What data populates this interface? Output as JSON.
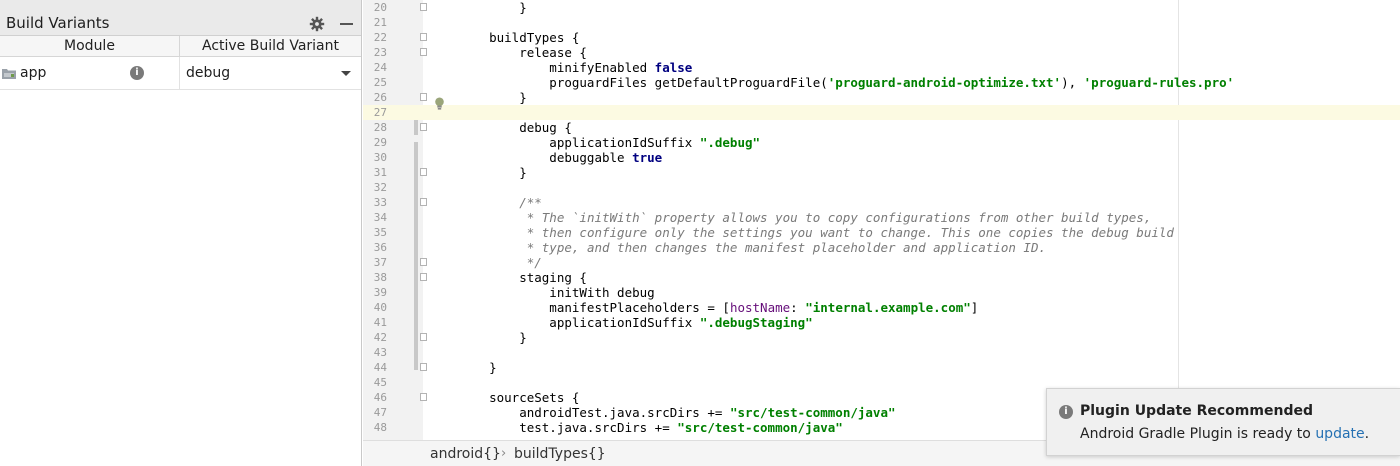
{
  "build_variants": {
    "title": "Build Variants",
    "columns": {
      "module": "Module",
      "variant": "Active Build Variant"
    },
    "rows": [
      {
        "module": "app",
        "variant": "debug"
      }
    ]
  },
  "editor": {
    "lines": [
      {
        "num": "20",
        "html": "        }"
      },
      {
        "num": "21",
        "html": ""
      },
      {
        "num": "22",
        "html": "    buildTypes {"
      },
      {
        "num": "23",
        "html": "        release {"
      },
      {
        "num": "24",
        "html": "            minifyEnabled <span class=\"kw\">false</span>"
      },
      {
        "num": "25",
        "html": "            proguardFiles getDefaultProguardFile(<span class=\"str\">'proguard-android-optimize.txt'</span>), <span class=\"str\">'proguard-rules.pro'</span>"
      },
      {
        "num": "26",
        "html": "        }"
      },
      {
        "num": "27",
        "html": ""
      },
      {
        "num": "28",
        "html": "        debug {"
      },
      {
        "num": "29",
        "html": "            applicationIdSuffix <span class=\"str\">\".debug\"</span>"
      },
      {
        "num": "30",
        "html": "            debuggable <span class=\"kw\">true</span>"
      },
      {
        "num": "31",
        "html": "        }"
      },
      {
        "num": "32",
        "html": ""
      },
      {
        "num": "33",
        "html": "        <span class=\"cmt\">/**</span>"
      },
      {
        "num": "34",
        "html": "         <span class=\"cmt\">* The `initWith` property allows you to copy configurations from other build types,</span>"
      },
      {
        "num": "35",
        "html": "         <span class=\"cmt\">* then configure only the settings you want to change. This one copies the debug build</span>"
      },
      {
        "num": "36",
        "html": "         <span class=\"cmt\">* type, and then changes the manifest placeholder and application ID.</span>"
      },
      {
        "num": "37",
        "html": "         <span class=\"cmt\">*/</span>"
      },
      {
        "num": "38",
        "html": "        staging {"
      },
      {
        "num": "39",
        "html": "            initWith debug"
      },
      {
        "num": "40",
        "html": "            manifestPlaceholders = [<span class=\"key\">hostName</span>: <span class=\"str\">\"internal.example.com\"</span>]"
      },
      {
        "num": "41",
        "html": "            applicationIdSuffix <span class=\"str\">\".debugStaging\"</span>"
      },
      {
        "num": "42",
        "html": "        }"
      },
      {
        "num": "43",
        "html": ""
      },
      {
        "num": "44",
        "html": "    }"
      },
      {
        "num": "45",
        "html": ""
      },
      {
        "num": "46",
        "html": "    sourceSets {"
      },
      {
        "num": "47",
        "html": "        androidTest.java.srcDirs += <span class=\"str\">\"src/test-common/java\"</span>"
      },
      {
        "num": "48",
        "html": "        test.java.srcDirs += <span class=\"str\">\"src/test-common/java\"</span>"
      }
    ],
    "current_line": "27",
    "fold_lines": [
      "20",
      "22",
      "23",
      "26",
      "28",
      "31",
      "33",
      "37",
      "38",
      "42",
      "44",
      "46"
    ]
  },
  "breadcrumb": {
    "items": [
      "android{}",
      "buildTypes{}"
    ],
    "separator": "›"
  },
  "notification": {
    "title": "Plugin Update Recommended",
    "body_prefix": "Android Gradle Plugin is ready to ",
    "link_text": "update",
    "body_suffix": "."
  },
  "icons": {
    "panel_settings": "gear-icon",
    "panel_minimize": "minimize-icon",
    "module": "module-folder-icon",
    "info": "info-icon",
    "dropdown": "chevron-down-icon",
    "intention": "lightbulb-icon"
  },
  "colors": {
    "current_line_bg": "#fcfae2",
    "keyword": "#000080",
    "string": "#008000",
    "comment": "#7a7a7a",
    "link": "#2470b3"
  }
}
